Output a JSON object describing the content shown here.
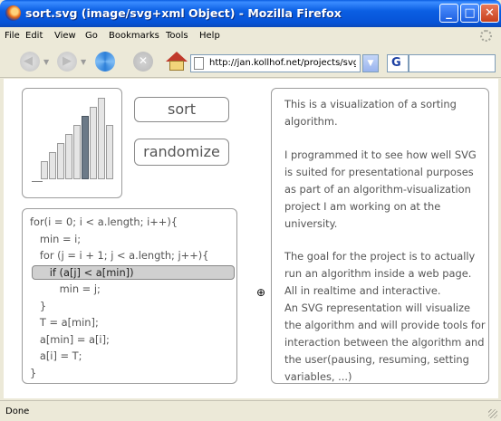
{
  "window": {
    "title": "sort.svg (image/svg+xml Object) - Mozilla Firefox"
  },
  "menu": [
    "File",
    "Edit",
    "View",
    "Go",
    "Bookmarks",
    "Tools",
    "Help"
  ],
  "address": {
    "url": "http://jan.kollhof.net/projects/svg/e:"
  },
  "content": {
    "buttons": {
      "sort": "sort",
      "randomize": "randomize"
    },
    "bars": [
      {
        "value": 2,
        "active": false
      },
      {
        "value": 3,
        "active": false
      },
      {
        "value": 4,
        "active": false
      },
      {
        "value": 5,
        "active": false
      },
      {
        "value": 6,
        "active": false
      },
      {
        "value": 7,
        "active": true
      },
      {
        "value": 8,
        "active": false
      },
      {
        "value": 9,
        "active": false
      },
      {
        "value": 6,
        "active": false
      }
    ],
    "code": [
      "for(i = 0; i < a.length; i++){",
      "   min = i;",
      "   for (j = i + 1; j < a.length; j++){",
      "      if (a[j] < a[min])",
      "         min = j;",
      "   }",
      "   T = a[min];",
      "   a[min] = a[i];",
      "   a[i] = T;",
      "}"
    ],
    "highlight_line": 3,
    "description": [
      "This is a visualization of a sorting algorithm.",
      "I programmed it to see how well SVG is suited for presentational purposes as part of an algorithm-visualization project I am working on at the university.",
      "The goal for the project is to actually run an algorithm inside a web page. All in realtime and interactive.",
      "An SVG representation will visualize the algorithm and will provide tools for interaction between the algorithm and the user(pausing, resuming, setting variables, ...)"
    ]
  },
  "status": "Done"
}
